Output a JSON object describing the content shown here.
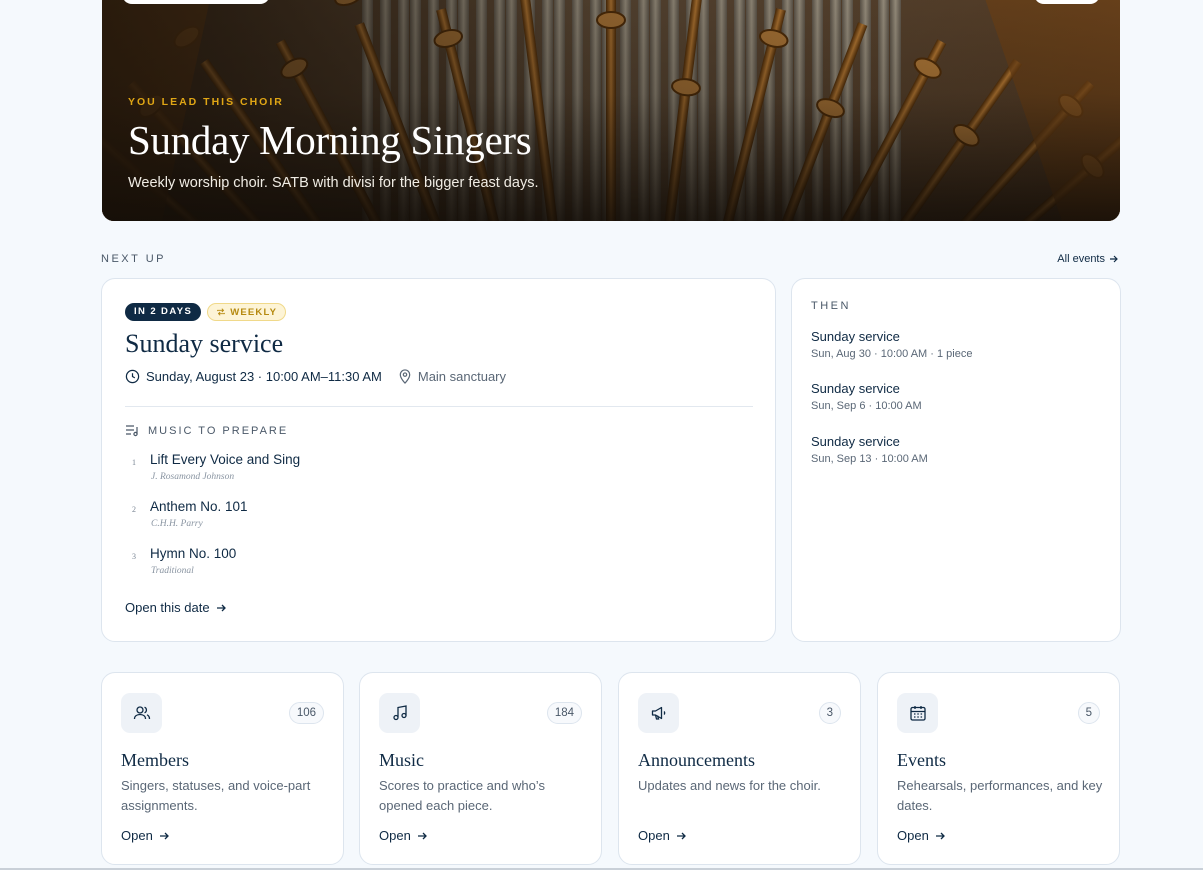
{
  "hero": {
    "eyebrow": "YOU LEAD THIS CHOIR",
    "title": "Sunday Morning Singers",
    "subtitle": "Weekly worship choir. SATB with divisi for the bigger feast days."
  },
  "next_up": {
    "section_label": "NEXT UP",
    "all_events_label": "All events",
    "badge_when": "IN 2 DAYS",
    "badge_recurrence": "WEEKLY",
    "event_title": "Sunday service",
    "when": "Sunday, August 23 · 10:00 AM–11:30 AM",
    "where": "Main sanctuary",
    "music_label": "MUSIC TO PREPARE",
    "pieces": [
      {
        "num": "1",
        "name": "Lift Every Voice and Sing",
        "composer": "J. Rosamond Johnson"
      },
      {
        "num": "2",
        "name": "Anthem No. 101",
        "composer": "C.H.H. Parry"
      },
      {
        "num": "3",
        "name": "Hymn No. 100",
        "composer": "Traditional"
      }
    ],
    "open_label": "Open this date"
  },
  "then": {
    "label": "THEN",
    "items": [
      {
        "title": "Sunday service",
        "sub": "Sun, Aug 30 · 10:00 AM · 1 piece"
      },
      {
        "title": "Sunday service",
        "sub": "Sun, Sep 6 · 10:00 AM"
      },
      {
        "title": "Sunday service",
        "sub": "Sun, Sep 13 · 10:00 AM"
      }
    ]
  },
  "features": [
    {
      "icon": "users-icon",
      "count": "106",
      "title": "Members",
      "desc": "Singers, statuses, and voice-part assignments.",
      "open": "Open"
    },
    {
      "icon": "music-note-icon",
      "count": "184",
      "title": "Music",
      "desc": "Scores to practice and who’s opened each piece.",
      "open": "Open"
    },
    {
      "icon": "megaphone-icon",
      "count": "3",
      "title": "Announcements",
      "desc": "Updates and news for the choir.",
      "open": "Open"
    },
    {
      "icon": "calendar-icon",
      "count": "5",
      "title": "Events",
      "desc": "Rehearsals, performances, and key dates.",
      "open": "Open"
    }
  ],
  "colors": {
    "navy": "#0f2a44",
    "gold": "#e0a615",
    "background": "#f5f9fd"
  }
}
